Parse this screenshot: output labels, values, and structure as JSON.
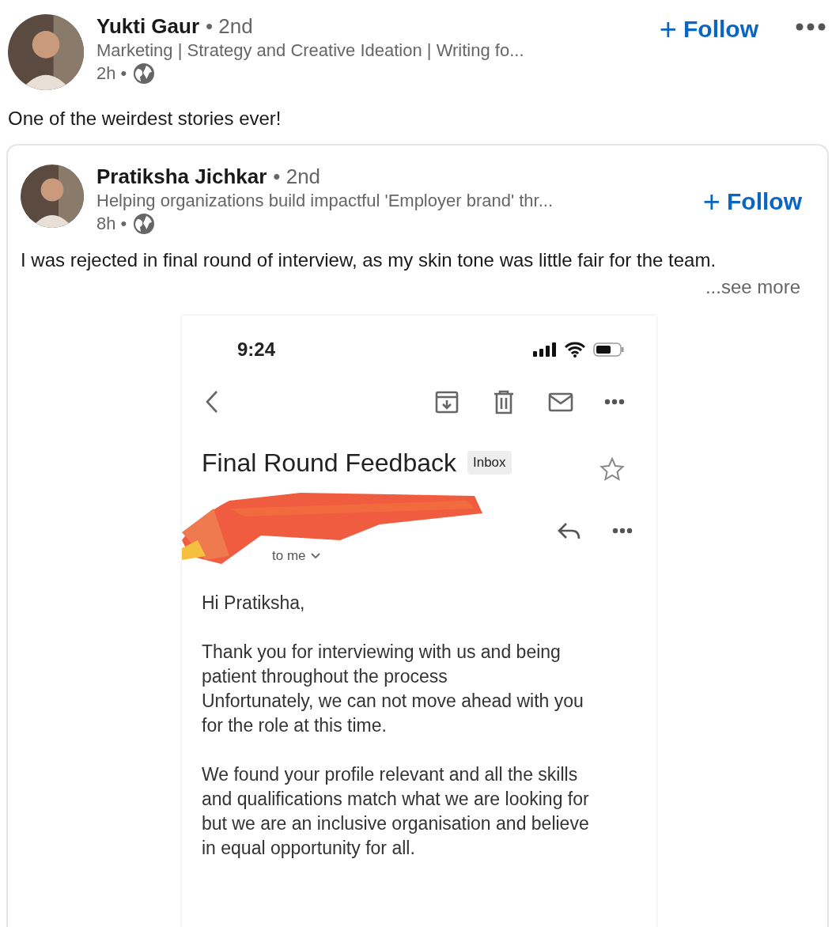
{
  "post": {
    "author": {
      "name": "Yukti Gaur",
      "degree": "• 2nd",
      "headline": "Marketing | Strategy and Creative Ideation | Writing fo...",
      "time": "2h •"
    },
    "follow": {
      "icon": "+",
      "label": "Follow"
    },
    "text": "One of the weirdest stories ever!",
    "shared": {
      "author": {
        "name": "Pratiksha Jichkar",
        "degree": "• 2nd",
        "headline": "Helping organizations build impactful 'Employer brand' thr...",
        "time": "8h •"
      },
      "follow": {
        "icon": "+",
        "label": "Follow"
      },
      "text": "I was rejected in final round of interview, as my skin tone was little fair for the team.",
      "see_more": "...see more",
      "screenshot": {
        "clock": "9:24",
        "subject": "Final Round Feedback",
        "label": "Inbox",
        "recipient": "to me",
        "body": [
          [
            "Hi Pratiksha,"
          ],
          [
            "Thank you for interviewing with us and being",
            "patient throughout the process",
            "Unfortunately, we can not move ahead with you",
            "for the role at this time."
          ],
          [
            "We found your profile relevant and all the skills",
            "and qualifications match what we are looking for",
            "but we are an inclusive organisation and believe",
            "in equal opportunity for all."
          ]
        ]
      }
    }
  }
}
